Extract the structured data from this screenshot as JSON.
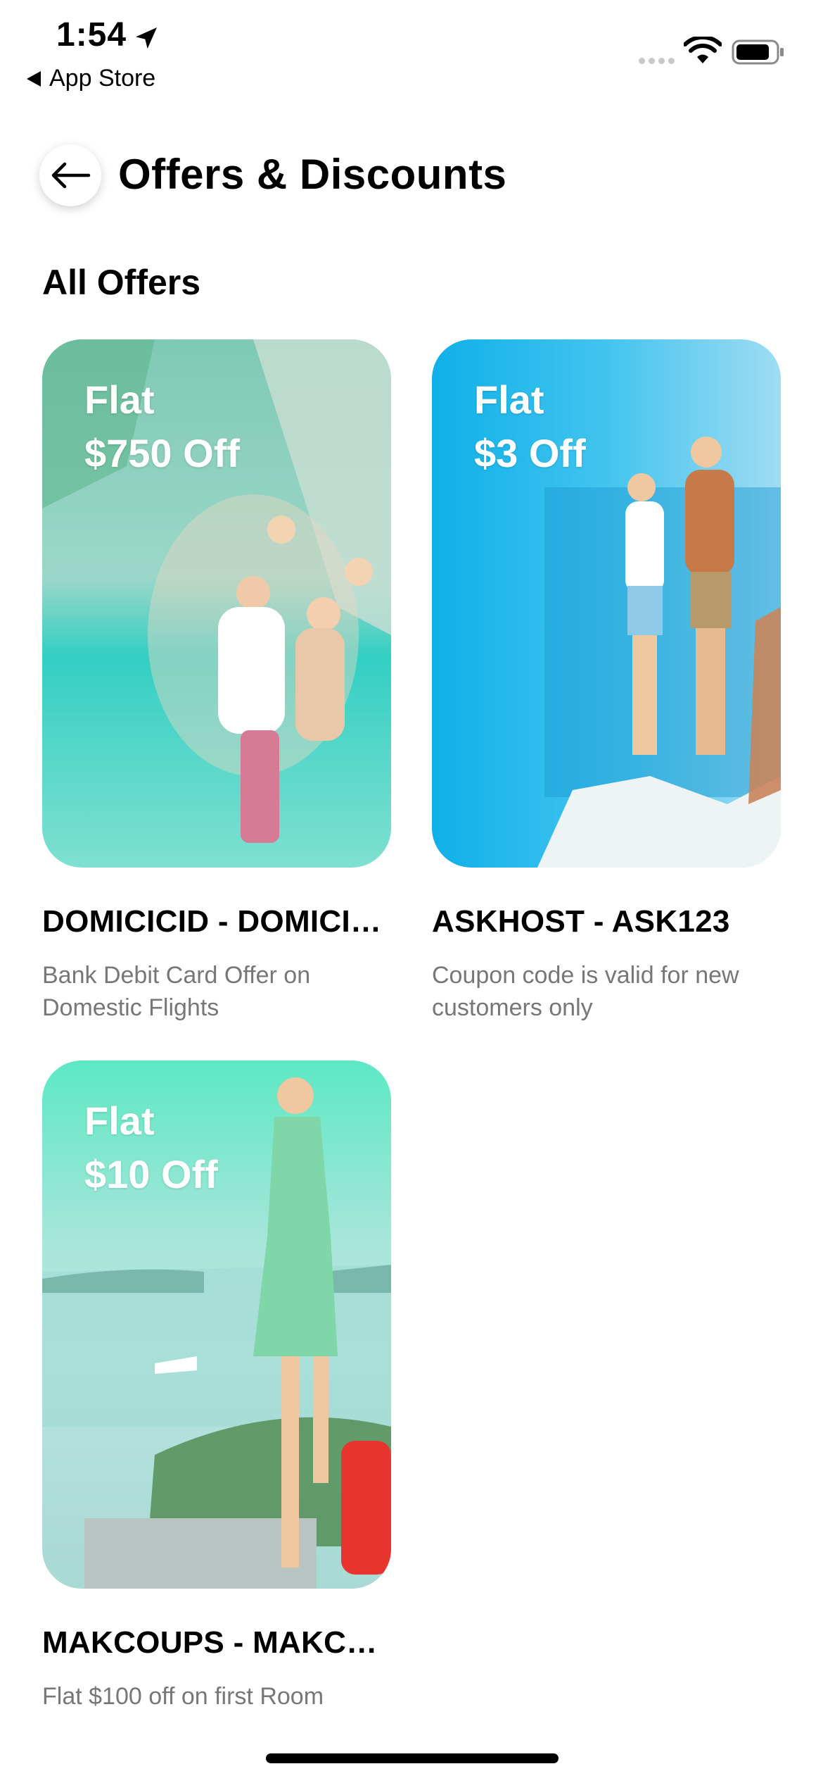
{
  "status_bar": {
    "time": "1:54",
    "back_app": "App Store"
  },
  "header": {
    "title": "Offers & Discounts"
  },
  "section_title": "All Offers",
  "offers": [
    {
      "flat_label": "Flat",
      "amount_label": "$750 Off",
      "code": "DOMICICID - DOMICICID",
      "description": "Bank Debit Card Offer on Domestic Flights",
      "theme": "#3fd0c0"
    },
    {
      "flat_label": "Flat",
      "amount_label": "$3 Off",
      "code": "ASKHOST - ASK123",
      "description": "Coupon code is valid for new customers only",
      "theme": "#1aa8e6"
    },
    {
      "flat_label": "Flat",
      "amount_label": "$10 Off",
      "code": "MAKCOUPS - MAKCOUPS",
      "description": "Flat $100 off on first Room",
      "theme": "#4fe0c0"
    }
  ]
}
